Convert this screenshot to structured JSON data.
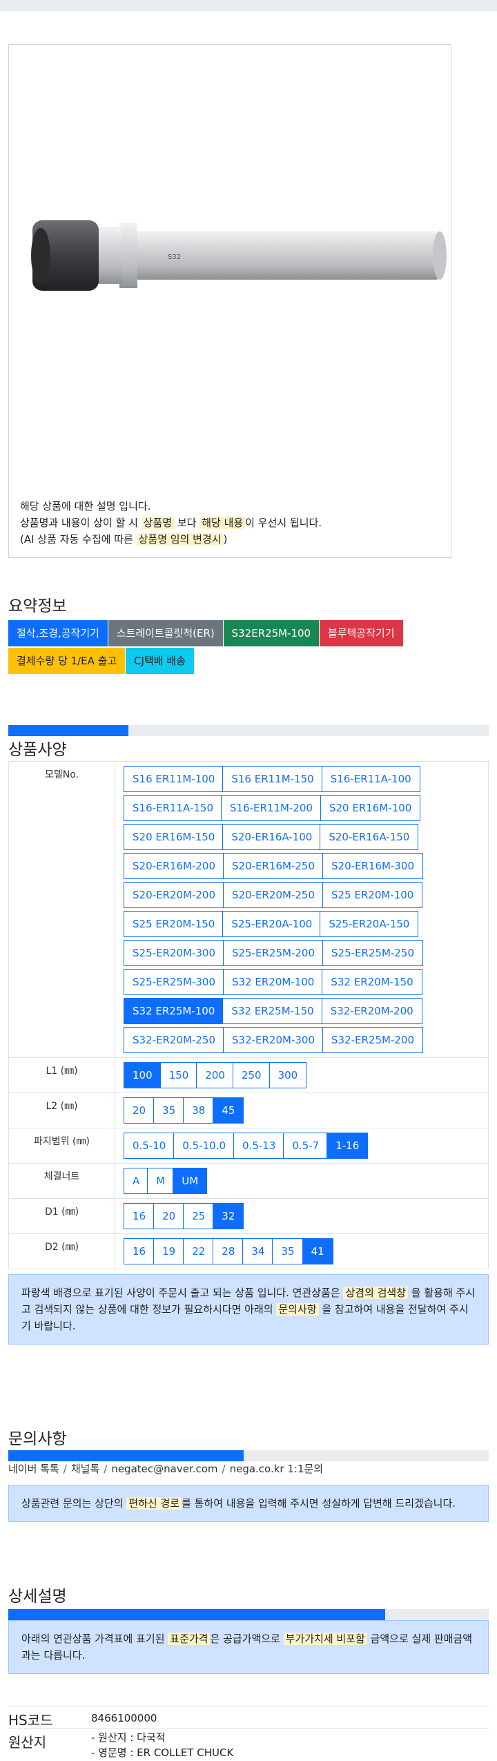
{
  "product": {
    "image_alt": "ER collet chuck straight shank",
    "desc_line1": "해당 상품에 대한 설명 입니다.",
    "desc_line2_a": "상품명과 내용이 상이 할 시 ",
    "desc_line2_mark1": "상품명",
    "desc_line2_b": " 보다 ",
    "desc_line2_mark2": "해당 내용",
    "desc_line2_c": "이 우선시 됩니다.",
    "desc_line3_a": "(AI 상품 자동 수집에 따른 ",
    "desc_line3_mark": "상품명 임의 변경시",
    "desc_line3_b": ")"
  },
  "summary": {
    "title": "요약정보",
    "badges": [
      "절삭,조경,공작기기",
      "스트레이트콜릿척(ER)",
      "S32ER25M-100",
      "블루텍공작기기",
      "결제수량 당 1/EA 출고",
      "CJ택배 배송"
    ]
  },
  "spec": {
    "title": "상품사양",
    "progress_percent": 25,
    "rows": [
      {
        "label": "모델No.",
        "options": [
          "S16 ER11M-100",
          "S16 ER11M-150",
          "S16-ER11A-100",
          "S16-ER11A-150",
          "S16-ER11M-200",
          "S20 ER16M-100",
          "S20 ER16M-150",
          "S20-ER16A-100",
          "S20-ER16A-150",
          "S20-ER16M-200",
          "S20-ER16M-250",
          "S20-ER16M-300",
          "S20-ER20M-200",
          "S20-ER20M-250",
          "S25 ER20M-100",
          "S25 ER20M-150",
          "S25-ER20A-100",
          "S25-ER20A-150",
          "S25-ER20M-300",
          "S25-ER25M-200",
          "S25-ER25M-250",
          "S25-ER25M-300",
          "S32 ER20M-100",
          "S32 ER20M-150",
          "S32 ER25M-100",
          "S32 ER25M-150",
          "S32-ER20M-200",
          "S32-ER20M-250",
          "S32-ER20M-300",
          "S32-ER25M-200"
        ],
        "selected": "S32 ER25M-100"
      },
      {
        "label": "L1 (㎜)",
        "options": [
          "100",
          "150",
          "200",
          "250",
          "300"
        ],
        "selected": "100"
      },
      {
        "label": "L2 (㎜)",
        "options": [
          "20",
          "35",
          "38",
          "45"
        ],
        "selected": "45"
      },
      {
        "label": "파지범위 (㎜)",
        "options": [
          "0.5-10",
          "0.5-10.0",
          "0.5-13",
          "0.5-7",
          "1-16"
        ],
        "selected": "1-16"
      },
      {
        "label": "체결너트",
        "options": [
          "A",
          "M",
          "UM"
        ],
        "selected": "UM"
      },
      {
        "label": "D1 (㎜)",
        "options": [
          "16",
          "20",
          "25",
          "32"
        ],
        "selected": "32"
      },
      {
        "label": "D2 (㎜)",
        "options": [
          "16",
          "19",
          "22",
          "28",
          "34",
          "35",
          "41"
        ],
        "selected": "41"
      }
    ],
    "notice_a": "파랑색 배경으로 표기된 사양이 주문시 출고 되는 상품 입니다. 연관상품은 ",
    "notice_mark1": "상겸의 검색창",
    "notice_b": " 을 활용해 주시고 검색되지 않는 상품에 대한 정보가 필요하시다면 아래의 ",
    "notice_mark2": "문의사항",
    "notice_c": " 을 참고하여 내용을 전달하여 주시기 바랍니다."
  },
  "inquiry": {
    "title": "문의사항",
    "progress_percent": 49,
    "contacts": [
      "네이버 톡톡",
      "채널톡",
      "negatec@naver.com",
      "nega.co.kr 1:1문의"
    ],
    "separator": "/",
    "notice_a": "상품관련 문의는 상단의 ",
    "notice_mark": "편하신 경로",
    "notice_b": "를 통하여 내용을 입력해 주시면 성실하게 답변해 드리겠습니다."
  },
  "detail": {
    "title": "상세설명",
    "progress_percent": 78.5,
    "notice_a": "아래의 연관상품 가격표에 표기된 ",
    "notice_mark1": "표준가격",
    "notice_b": "은 공급가액으로 ",
    "notice_mark2": "부가가치세 비포함",
    "notice_c": " 금액으로 실제 판매금액과는 다릅니다.",
    "hs_label": "HS코드",
    "hs_value": "8466100000",
    "origin_label": "원산지",
    "origin_line1": "- 원산지 : 다국적",
    "origin_line2": "- 영문명 : ER COLLET CHUCK"
  }
}
